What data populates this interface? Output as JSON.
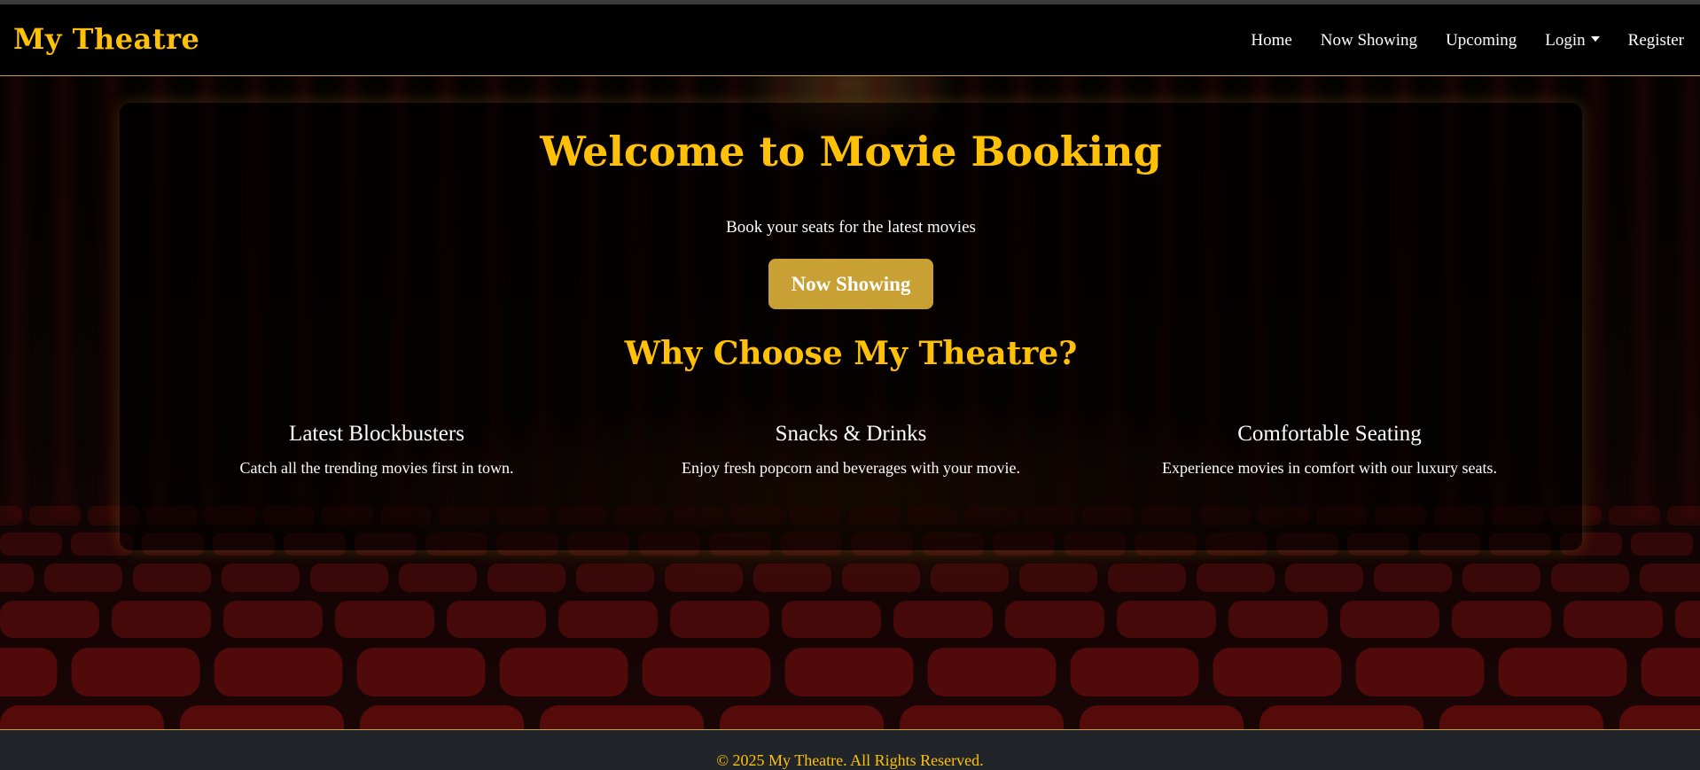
{
  "navbar": {
    "brand": "My Theatre",
    "links": [
      {
        "label": "Home"
      },
      {
        "label": "Now Showing"
      },
      {
        "label": "Upcoming"
      },
      {
        "label": "Login"
      },
      {
        "label": "Register"
      }
    ]
  },
  "hero": {
    "title": "Welcome to Movie Booking",
    "subtitle": "Book your seats for the latest movies",
    "cta_label": "Now Showing"
  },
  "why": {
    "title": "Why Choose My Theatre?",
    "features": [
      {
        "title": "Latest Blockbusters",
        "text": "Catch all the trending movies first in town."
      },
      {
        "title": "Snacks & Drinks",
        "text": "Enjoy fresh popcorn and beverages with your movie."
      },
      {
        "title": "Comfortable Seating",
        "text": "Experience movies in comfort with our luxury seats."
      }
    ]
  },
  "footer": {
    "text": "© 2025 My Theatre. All Rights Reserved."
  },
  "colors": {
    "accent": "#ffc107",
    "button": "#c9a034",
    "footer_bg": "#212529",
    "seat": "#5a0c0c"
  }
}
